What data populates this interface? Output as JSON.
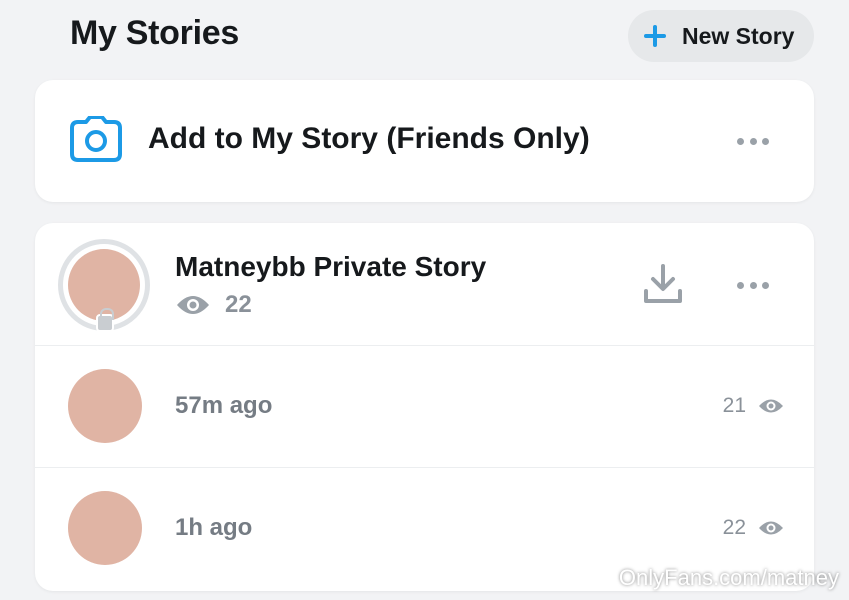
{
  "header": {
    "title": "My Stories",
    "new_story_label": "New Story"
  },
  "add_story": {
    "label": "Add to My Story (Friends Only)",
    "icon": "camera-icon"
  },
  "private_story": {
    "title": "Matneybb Private Story",
    "viewers": "22",
    "icons": [
      "eye-icon",
      "download-icon",
      "more-icon",
      "lock-icon"
    ]
  },
  "snaps": [
    {
      "time": "57m ago",
      "views": "21"
    },
    {
      "time": "1h ago",
      "views": "22"
    }
  ],
  "watermark": "OnlyFans.com/matney",
  "colors": {
    "accent": "#1c9ae6",
    "background": "#f2f3f5",
    "card": "#ffffff",
    "muted_text": "#8a9199"
  }
}
